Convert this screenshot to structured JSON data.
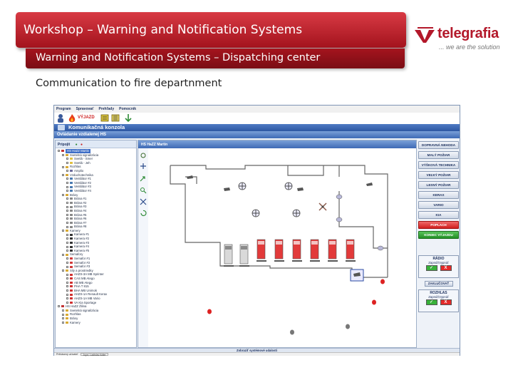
{
  "slide": {
    "title": "Workshop – Warning and Notification Systems",
    "subtitle": "Warning and Notification Systems – Dispatching center",
    "caption": "Communication to fire departnment"
  },
  "logo": {
    "brand": "telegrafia",
    "slogan": "... we are the solution",
    "accent_color": "#b3182a"
  },
  "app": {
    "menu": [
      "Program",
      "Spravovať",
      "Prehľady",
      "Pomocník"
    ],
    "toolbar_label": "VÝJAZD",
    "window_title": "Komunikačná konzola",
    "section_title": "Ovládanie vzdialenej HS",
    "tree_header": "Pripojit",
    "tree": [
      {
        "label": "HS HaZZ Martin",
        "level": 0,
        "icon": "station-icon",
        "selected": true
      },
      {
        "label": "Svetelná signalizácia",
        "level": 1,
        "icon": "folder-icon"
      },
      {
        "label": "Svetlá - Smer",
        "level": 2,
        "icon": "light-icon"
      },
      {
        "label": "Svetlá - Jeh",
        "level": 2,
        "icon": "light-icon"
      },
      {
        "label": "Rozhlas",
        "level": 1,
        "icon": "folder-icon"
      },
      {
        "label": "Amplio",
        "level": 2,
        "icon": "speaker-icon"
      },
      {
        "label": "Vzduchotechnika",
        "level": 1,
        "icon": "folder-icon"
      },
      {
        "label": "Ventilátor #1",
        "level": 2,
        "icon": "fan-icon"
      },
      {
        "label": "Ventilátor #2",
        "level": 2,
        "icon": "fan-icon"
      },
      {
        "label": "Ventilátor #3",
        "level": 2,
        "icon": "fan-icon"
      },
      {
        "label": "Ventilátor #4",
        "level": 2,
        "icon": "fan-icon"
      },
      {
        "label": "Brány",
        "level": 1,
        "icon": "folder-icon"
      },
      {
        "label": "Brána #1",
        "level": 2,
        "icon": "gate-icon"
      },
      {
        "label": "Brána #2",
        "level": 2,
        "icon": "gate-icon"
      },
      {
        "label": "Brána #3",
        "level": 2,
        "icon": "gate-icon"
      },
      {
        "label": "Brána #4",
        "level": 2,
        "icon": "gate-icon"
      },
      {
        "label": "Brána #5",
        "level": 2,
        "icon": "gate-icon"
      },
      {
        "label": "Brána #6",
        "level": 2,
        "icon": "gate-icon"
      },
      {
        "label": "Brána #7",
        "level": 2,
        "icon": "gate-icon"
      },
      {
        "label": "Brána #8",
        "level": 2,
        "icon": "gate-icon"
      },
      {
        "label": "Kamery",
        "level": 1,
        "icon": "folder-icon"
      },
      {
        "label": "Kamera #1",
        "level": 2,
        "icon": "camera-icon"
      },
      {
        "label": "Kamera #2",
        "level": 2,
        "icon": "camera-icon"
      },
      {
        "label": "Kamera #3",
        "level": 2,
        "icon": "camera-icon"
      },
      {
        "label": "Kamera #4",
        "level": 2,
        "icon": "camera-icon"
      },
      {
        "label": "Kamera #5",
        "level": 2,
        "icon": "camera-icon"
      },
      {
        "label": "Semafory",
        "level": 1,
        "icon": "folder-icon"
      },
      {
        "label": "Semafor #1",
        "level": 2,
        "icon": "semaphore-icon"
      },
      {
        "label": "Semafor #2",
        "level": 2,
        "icon": "semaphore-icon"
      },
      {
        "label": "Semafor #3",
        "level": 2,
        "icon": "semaphore-icon"
      },
      {
        "label": "Sily a prostriedky",
        "level": 1,
        "icon": "folder-icon"
      },
      {
        "label": "AHZS-3A MB Sprinter",
        "level": 2,
        "icon": "truck-icon"
      },
      {
        "label": "CAS MB Atego",
        "level": 2,
        "icon": "truck-icon"
      },
      {
        "label": "AB MB Atego",
        "level": 2,
        "icon": "truck-icon"
      },
      {
        "label": "PHA T 815",
        "level": 2,
        "icon": "truck-icon"
      },
      {
        "label": "BHA MB Unimok",
        "level": 2,
        "icon": "truck-icon"
      },
      {
        "label": "AHZS-1A Renault Kerax",
        "level": 2,
        "icon": "truck-icon"
      },
      {
        "label": "AHZS-1A MB Vario",
        "level": 2,
        "icon": "truck-icon"
      },
      {
        "label": "VA Kia Sportage",
        "level": 2,
        "icon": "truck-icon"
      },
      {
        "label": "HS HaZZ Žilina",
        "level": 0,
        "icon": "station-icon"
      },
      {
        "label": "Svetelná signalizácia",
        "level": 1,
        "icon": "folder-icon"
      },
      {
        "label": "Rozhlas",
        "level": 1,
        "icon": "folder-icon"
      },
      {
        "label": "Brány",
        "level": 1,
        "icon": "folder-icon"
      },
      {
        "label": "Kamery",
        "level": 1,
        "icon": "folder-icon"
      }
    ],
    "map_title": "HS HaZZ Martin",
    "actions": [
      {
        "label": "DOPRAVNÁ NEHODA",
        "style": "normal"
      },
      {
        "label": "MALÝ POŽIAR",
        "style": "normal"
      },
      {
        "label": "VÝŠKOVÁ TECHNIKA",
        "style": "normal"
      },
      {
        "label": "VEĽKÝ POŽIAR",
        "style": "normal"
      },
      {
        "label": "LESNÝ POŽIAR",
        "style": "normal"
      },
      {
        "label": "KERAX",
        "style": "normal"
      },
      {
        "label": "VARIO",
        "style": "normal"
      },
      {
        "label": "KIA",
        "style": "normal"
      },
      {
        "label": "POPLACH",
        "style": "alarm"
      },
      {
        "label": "KONIEC VÝJAZDU",
        "style": "end"
      }
    ],
    "radio": {
      "title": "RÁDIO",
      "sub": "Zapnúť/Vypnúť",
      "ok": "✓",
      "cancel": "X",
      "knock": "ZAKLUČOVAŤ"
    },
    "broadcast": {
      "title": "ROZHLAS",
      "sub": "Zapnúť/Vypnúť",
      "ok": "✓",
      "cancel": "X"
    },
    "message_bar": "Zobraziť systémové udalosti",
    "status": {
      "label": "Prihlásený užívateľ",
      "user": "Jupe, Ladislav Adler"
    }
  }
}
